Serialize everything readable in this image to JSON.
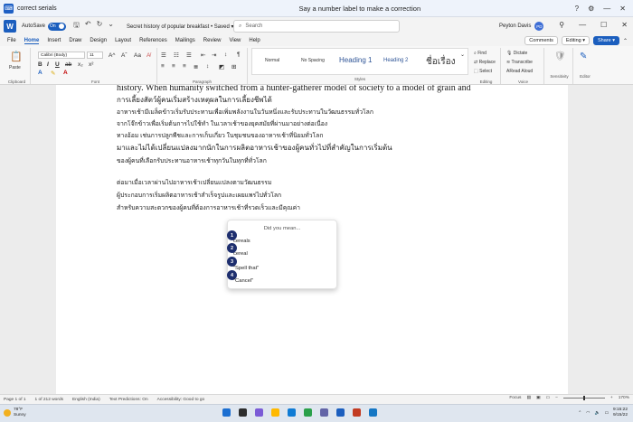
{
  "voice_bar": {
    "app_label": "correct serials",
    "message": "Say a number label to make a correction",
    "controls": [
      "?",
      "⚙",
      "—",
      "✕"
    ]
  },
  "title_bar": {
    "app_icon": "W",
    "autosave_label": "AutoSave",
    "autosave_state": "On",
    "doc_title": "Secret history of popular breakfast • Saved ▾",
    "search_placeholder": "Search",
    "user_name": "Peyton Davis",
    "user_initials": "PD"
  },
  "tabs": [
    "File",
    "Home",
    "Insert",
    "Draw",
    "Design",
    "Layout",
    "References",
    "Mailings",
    "Review",
    "View",
    "Help"
  ],
  "tabs_right": {
    "comments": "Comments",
    "editing": "Editing ▾",
    "share": "Share ▾"
  },
  "ribbon": {
    "clipboard": {
      "paste": "Paste",
      "label": "Clipboard"
    },
    "font": {
      "name": "Calibri (Body)",
      "size": "11",
      "label": "Font"
    },
    "paragraph": {
      "label": "Paragraph"
    },
    "styles": {
      "items": [
        "Normal",
        "No Spacing",
        "Heading 1",
        "Heading 2",
        "ชื่อเรื่อง"
      ],
      "label": "Styles"
    },
    "editing": {
      "find": "Find",
      "replace": "Replace",
      "select": "Select",
      "label": "Editing"
    },
    "voice": {
      "dictate": "Dictate",
      "transcribe": "Transcribe",
      "read_aloud": "Read Aloud",
      "label": "Voice"
    },
    "sensitivity": {
      "label": "Sensitivity"
    },
    "editor": {
      "label": "Editor"
    }
  },
  "document": {
    "lines": [
      "history. When humanity switched from a hunter-gatherer model of society to a model of grain and",
      "การเลี้ยงสัตว์ผู้คนเริ่มสร้างเหตุผลในการเลี้ยงชีพได้",
      "อาหารเช้ามีเมล็ดข้าวเริ่มรับประทานเพื่อเพิ่มพลังงานในวันหนึ่งและรับประทานในวัฒนธรรมทั่วโลก",
      "จากโจ๊กข้าวเพื่อเริ่มต้นการไปใช้ทำ ในเวลาเช้าของยุคสมัยที่ผ่านมาอย่างต่อเนื่อง",
      "ทางอ้อม เช่นการปลูกพืชและการเก็บเกี่ยว ในชุมชนของอาหารเช้าที่นิยมทั่วโลก",
      "มาและไม่ได้เปลี่ยนแปลงมากนักในการผลิตอาหารเช้าของผู้คนทั่วไปที่สำคัญในการเริ่มต้น",
      "ของผู้คนที่เลือกรับประทานอาหารเช้าทุกวันในทุกที่ทั่วโลก",
      "ต่อมาเมื่อเวลาผ่านไปอาหารเช้าเปลี่ยนแปลงตามวัฒนธรรม",
      "ผู้ประกอบการเริ่มผลิตอาหารเช้าสำเร็จรูปและเผยแพร่ไปทั่วโลก",
      "สำหรับความสะดวกของผู้คนที่ต้องการอาหารเช้าที่รวดเร็วและมีคุณค่า"
    ]
  },
  "popup": {
    "title": "Did you mean...",
    "options": [
      {
        "num": "1",
        "text": "cereals"
      },
      {
        "num": "2",
        "text": "cereal"
      },
      {
        "num": "3",
        "text": ""
      },
      {
        "num": "4",
        "text": "\"Spell that\""
      },
      {
        "num": "",
        "text": "\"Cancel\""
      }
    ]
  },
  "status_bar": {
    "page": "Page 1 of 1",
    "words": "1 of 212 words",
    "language": "English (India)",
    "predictions": "Text Predictions: On",
    "accessibility": "Accessibility: Good to go",
    "focus": "Focus",
    "zoom": "170%"
  },
  "taskbar": {
    "weather_temp": "78°F",
    "weather_desc": "Sunny",
    "time": "9:15:22",
    "date": "9/15/22",
    "app_colors": [
      "#1c6fd1",
      "#2d2d2d",
      "#7b5bd6",
      "#ffb900",
      "#0f7bd4",
      "#2aa04a",
      "#6264a7",
      "#1b5ebe",
      "#c23b22",
      "#1577c4"
    ]
  },
  "colors": {
    "accent": "#1b5ebe",
    "badge": "#1e2f6f"
  }
}
